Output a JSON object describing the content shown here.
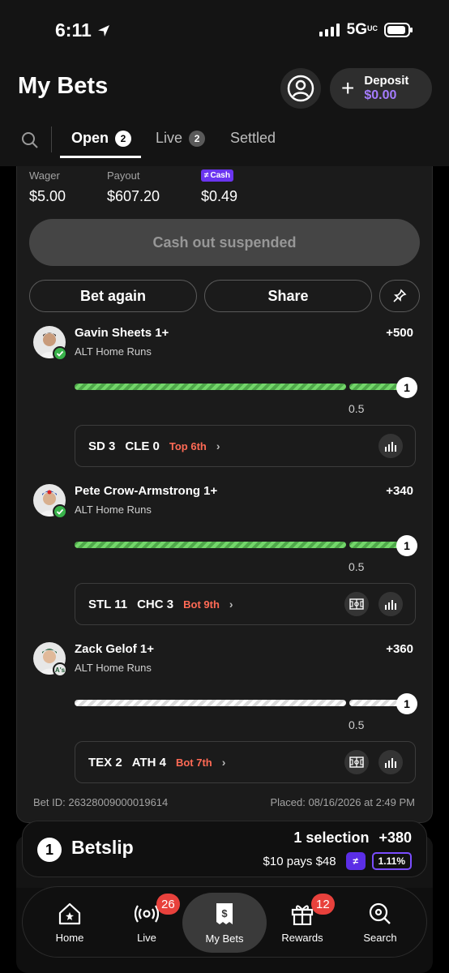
{
  "status_bar": {
    "time": "6:11",
    "network": "5G",
    "network_suffix": "UC"
  },
  "header": {
    "title": "My Bets",
    "deposit_label": "Deposit",
    "deposit_amount": "$0.00"
  },
  "tabs": [
    {
      "label": "Open",
      "count": "2",
      "active": true
    },
    {
      "label": "Live",
      "count": "2",
      "active": false
    },
    {
      "label": "Settled",
      "active": false
    }
  ],
  "bet": {
    "wager_label": "Wager",
    "wager_value": "$5.00",
    "payout_label": "Payout",
    "payout_value": "$607.20",
    "cash_badge_label": "Cash",
    "cash_value": "$0.49",
    "cashout_label": "Cash out suspended",
    "bet_again_label": "Bet again",
    "share_label": "Share",
    "legs": [
      {
        "player": "Gavin Sheets 1+",
        "market": "ALT Home Runs",
        "odds": "+500",
        "progress_value": "1",
        "threshold": "0.5",
        "status": "won",
        "game": {
          "away": "SD",
          "away_score": "3",
          "home": "CLE",
          "home_score": "0",
          "inning": "Top 6th"
        }
      },
      {
        "player": "Pete Crow-Armstrong 1+",
        "market": "ALT Home Runs",
        "odds": "+340",
        "progress_value": "1",
        "threshold": "0.5",
        "status": "won",
        "game": {
          "away": "STL",
          "away_score": "11",
          "home": "CHC",
          "home_score": "3",
          "inning": "Bot 9th"
        }
      },
      {
        "player": "Zack Gelof 1+",
        "market": "ALT Home Runs",
        "odds": "+360",
        "progress_value": "1",
        "threshold": "0.5",
        "status": "pending",
        "game": {
          "away": "TEX",
          "away_score": "2",
          "home": "ATH",
          "home_score": "4",
          "inning": "Bot 7th"
        }
      }
    ],
    "bet_id": "Bet ID: 26328009000019614",
    "placed": "Placed: 08/16/2026 at 2:49 PM"
  },
  "betslip": {
    "count": "1",
    "title": "Betslip",
    "selection_text": "1 selection",
    "odds": "+380",
    "pays_text": "$10 pays $48",
    "boost_pct": "1.11%"
  },
  "bottom_nav": [
    {
      "label": "Home",
      "icon": "home-icon"
    },
    {
      "label": "Live",
      "icon": "live-icon",
      "badge": "26"
    },
    {
      "label": "My Bets",
      "icon": "my-bets-icon",
      "active": true
    },
    {
      "label": "Rewards",
      "icon": "gift-icon",
      "badge": "12"
    },
    {
      "label": "Search",
      "icon": "search-icon"
    }
  ],
  "colors": {
    "accent_purple": "#a57cff",
    "won_green": "#38b24a",
    "inning_red": "#ff6a55",
    "badge_red": "#e8413c"
  }
}
